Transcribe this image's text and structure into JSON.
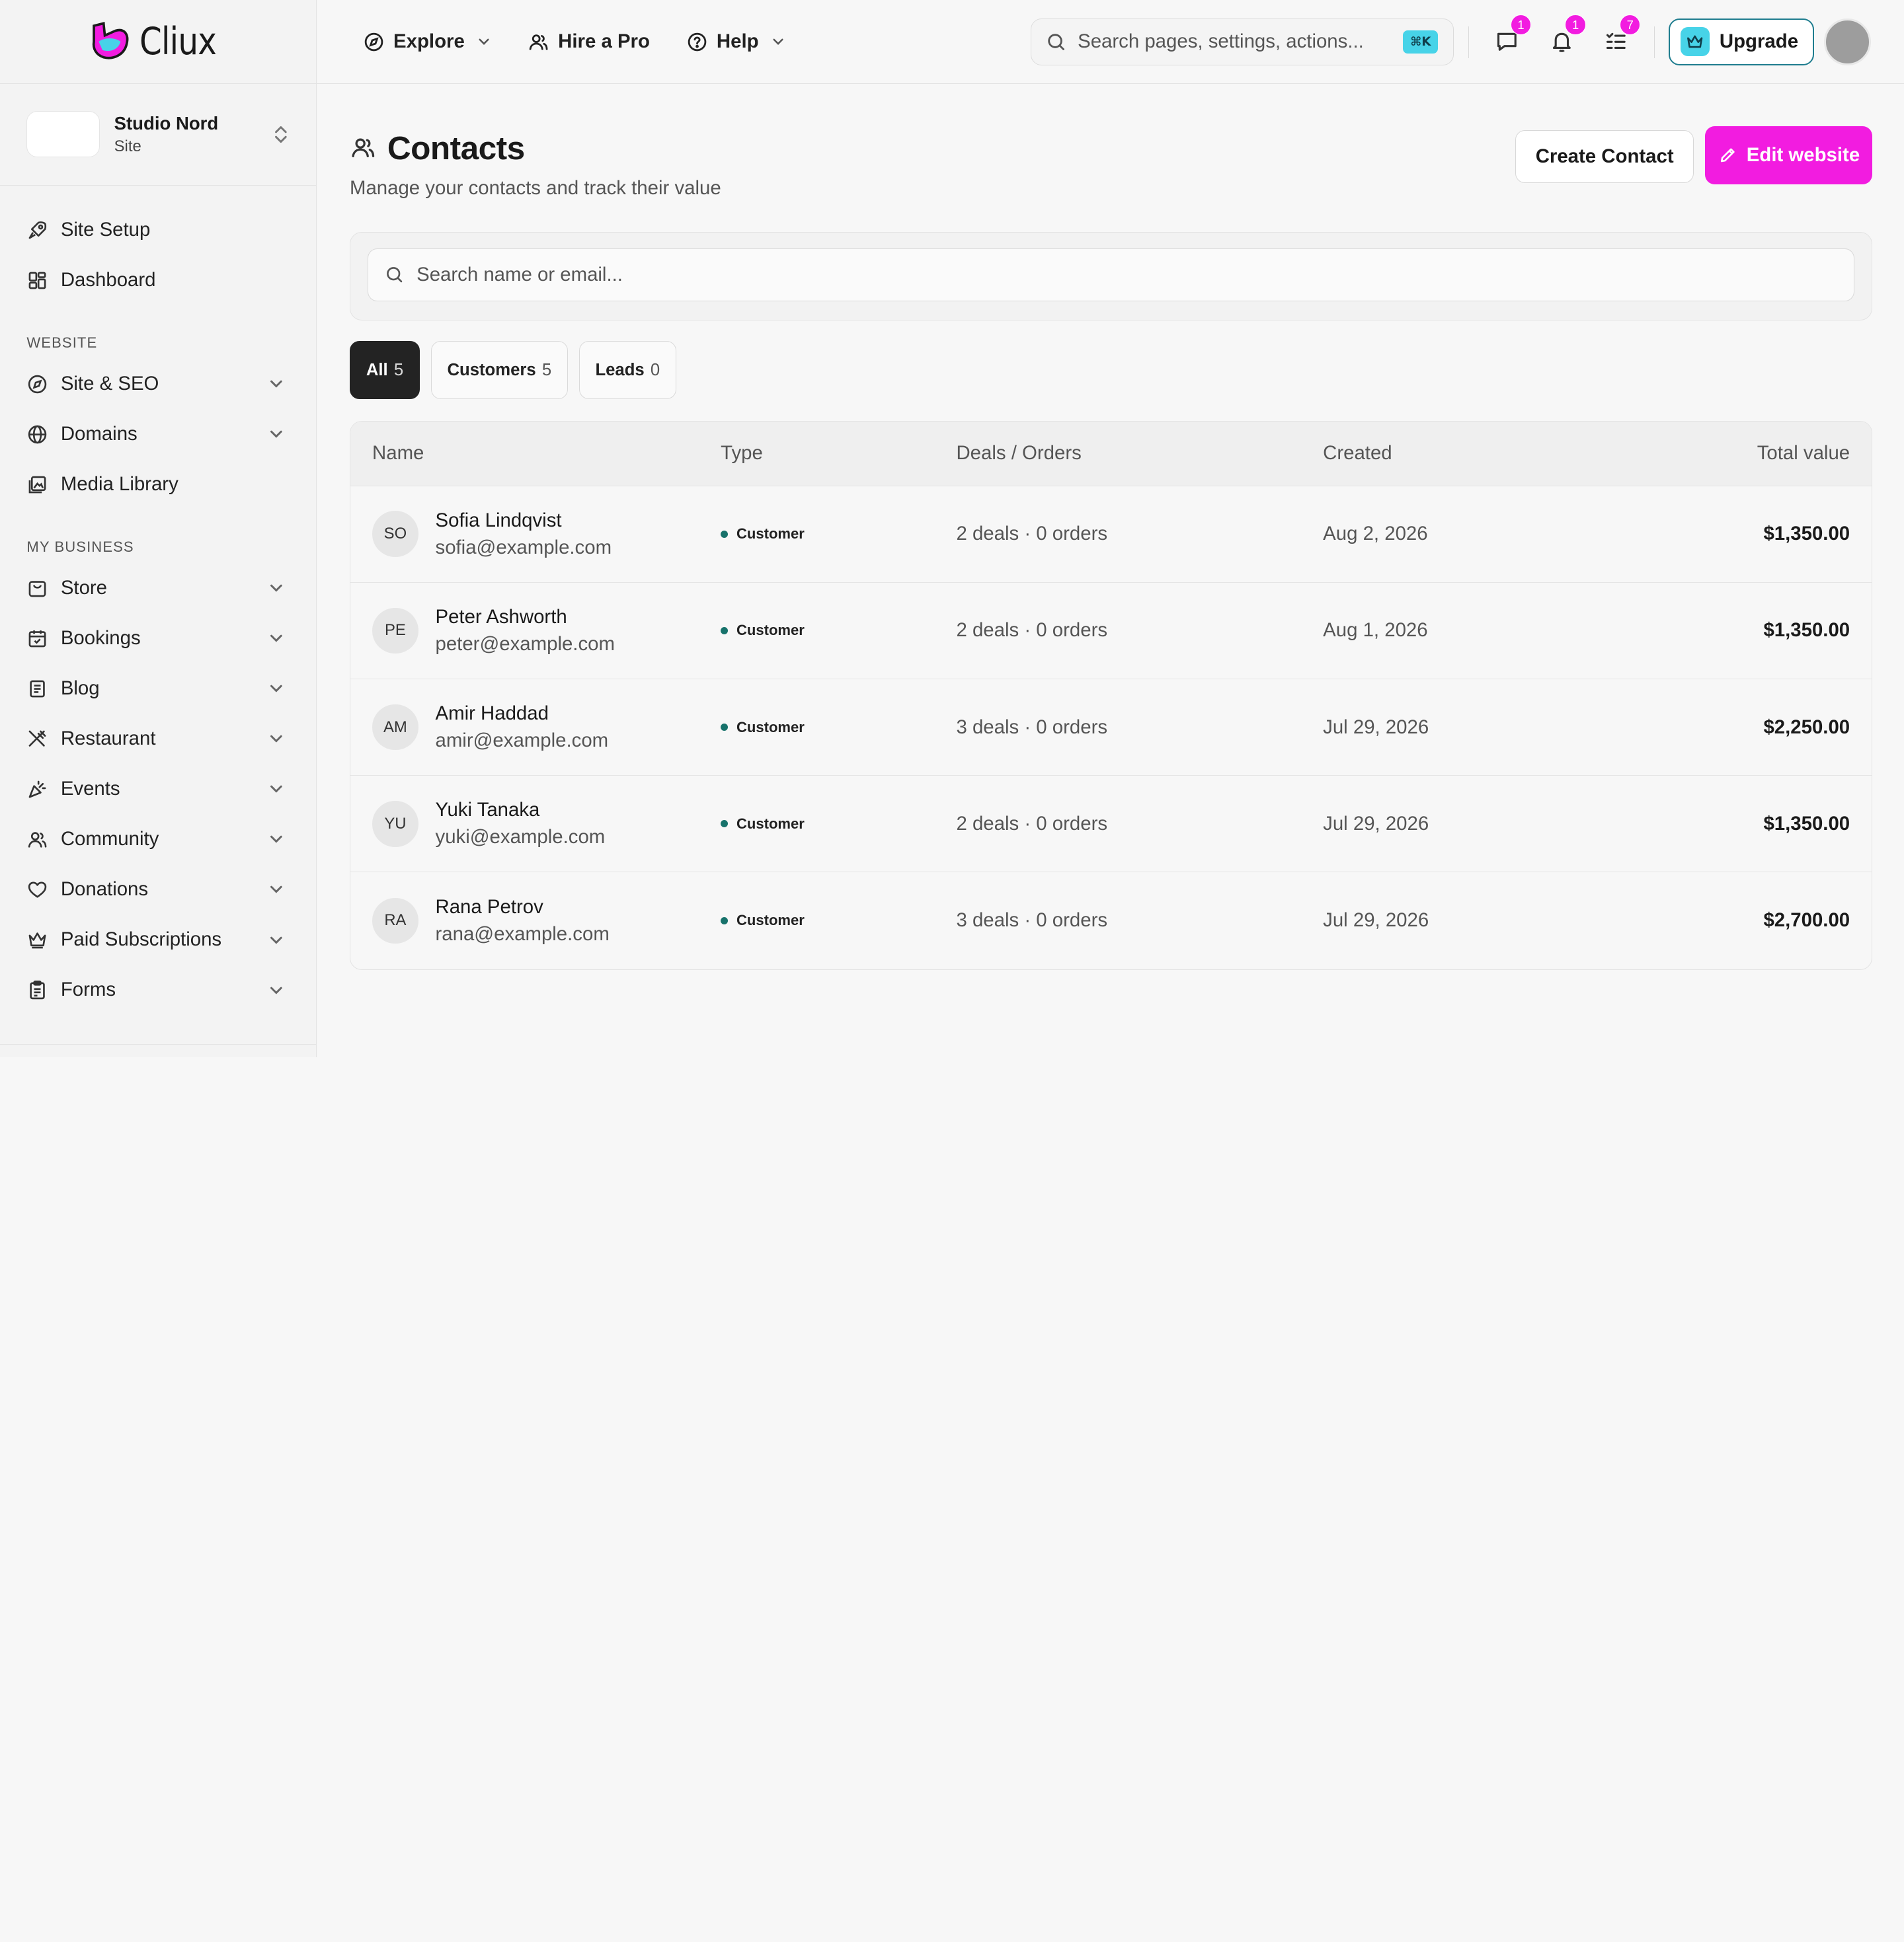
{
  "app": {
    "logo_text": "Cliux"
  },
  "site": {
    "name": "Studio Nord",
    "kind": "Site"
  },
  "sidebar": {
    "top_items": [
      {
        "label": "Site Setup"
      },
      {
        "label": "Dashboard"
      }
    ],
    "sections": [
      {
        "title": "WEBSITE",
        "items": [
          {
            "label": "Site & SEO"
          },
          {
            "label": "Domains"
          },
          {
            "label": "Media Library"
          }
        ]
      },
      {
        "title": "MY BUSINESS",
        "items": [
          {
            "label": "Store"
          },
          {
            "label": "Bookings"
          },
          {
            "label": "Blog"
          },
          {
            "label": "Restaurant"
          },
          {
            "label": "Events"
          },
          {
            "label": "Community"
          },
          {
            "label": "Donations"
          },
          {
            "label": "Paid Subscriptions"
          },
          {
            "label": "Forms"
          }
        ]
      }
    ]
  },
  "topbar": {
    "menu": [
      {
        "label": "Explore"
      },
      {
        "label": "Hire a Pro"
      },
      {
        "label": "Help"
      }
    ],
    "search_placeholder": "Search pages, settings, actions...",
    "shortcut": "⌘K",
    "badges": {
      "messages": "1",
      "notifications": "1",
      "tasks": "7"
    },
    "upgrade_label": "Upgrade"
  },
  "page": {
    "title": "Contacts",
    "subtitle": "Manage your contacts and track their value",
    "create_label": "Create Contact",
    "edit_label": "Edit website",
    "search_placeholder": "Search name or email...",
    "filters": [
      {
        "label": "All",
        "count": "5"
      },
      {
        "label": "Customers",
        "count": "5"
      },
      {
        "label": "Leads",
        "count": "0"
      }
    ]
  },
  "table": {
    "columns": {
      "name": "Name",
      "type": "Type",
      "deals": "Deals / Orders",
      "created": "Created",
      "total": "Total value"
    },
    "rows": [
      {
        "initials": "SO",
        "name": "Sofia Lindqvist",
        "email": "sofia@example.com",
        "type": "Customer",
        "deals": "2 deals · 0 orders",
        "created": "Aug 2, 2026",
        "total": "$1,350.00"
      },
      {
        "initials": "PE",
        "name": "Peter Ashworth",
        "email": "peter@example.com",
        "type": "Customer",
        "deals": "2 deals · 0 orders",
        "created": "Aug 1, 2026",
        "total": "$1,350.00"
      },
      {
        "initials": "AM",
        "name": "Amir Haddad",
        "email": "amir@example.com",
        "type": "Customer",
        "deals": "3 deals · 0 orders",
        "created": "Jul 29, 2026",
        "total": "$2,250.00"
      },
      {
        "initials": "YU",
        "name": "Yuki Tanaka",
        "email": "yuki@example.com",
        "type": "Customer",
        "deals": "2 deals · 0 orders",
        "created": "Jul 29, 2026",
        "total": "$1,350.00"
      },
      {
        "initials": "RA",
        "name": "Rana Petrov",
        "email": "rana@example.com",
        "type": "Customer",
        "deals": "3 deals · 0 orders",
        "created": "Jul 29, 2026",
        "total": "$2,700.00"
      }
    ]
  },
  "colors": {
    "accent": "#f21ce0",
    "brand_cyan": "#47d3e8",
    "status_customer": "#17726b"
  }
}
